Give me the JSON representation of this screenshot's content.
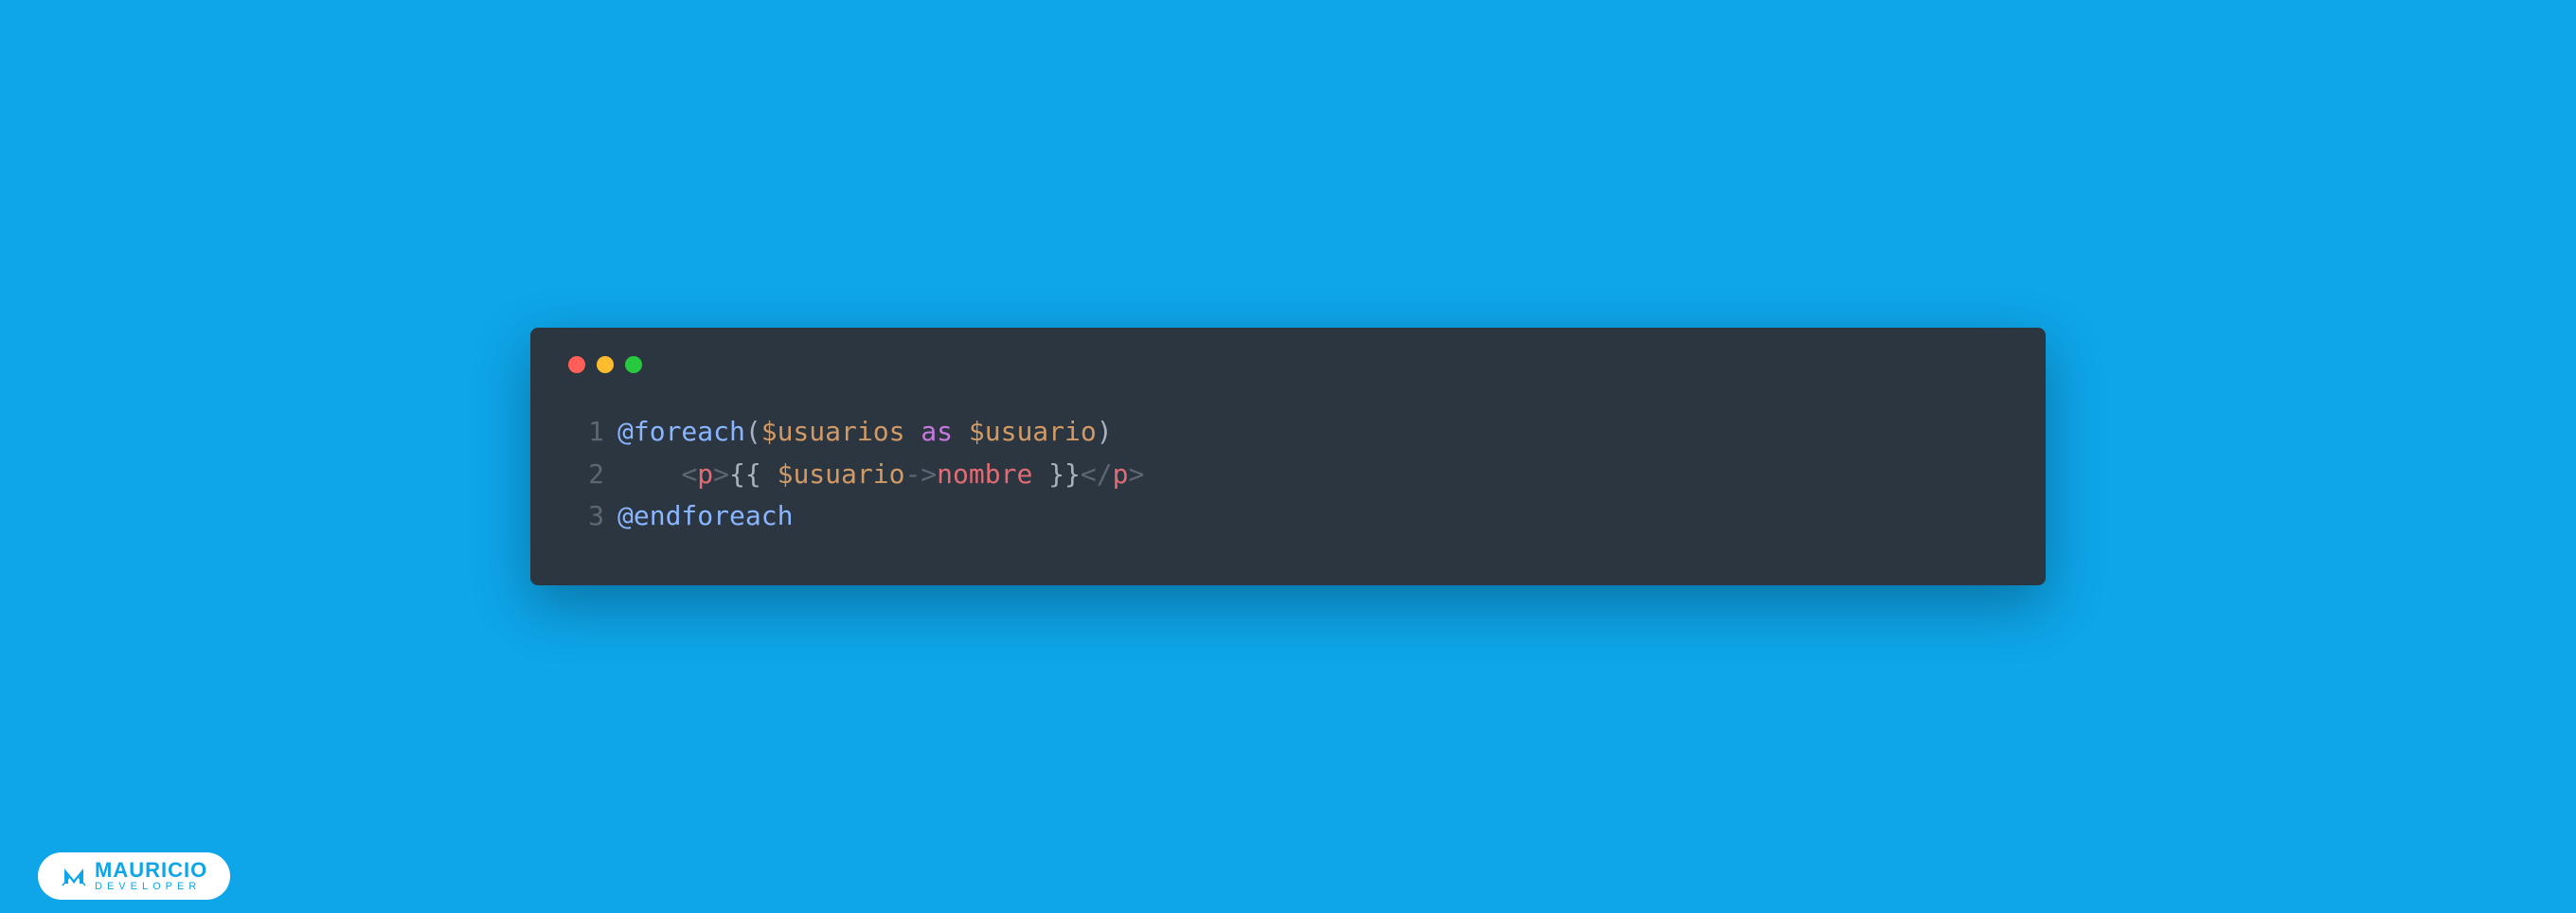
{
  "code": {
    "lines": [
      {
        "number": "1",
        "tokens": {
          "directive": "@foreach",
          "paren_open": "(",
          "var1": "$usuarios",
          "space1": " ",
          "keyword": "as",
          "space2": " ",
          "var2": "$usuario",
          "paren_close": ")"
        }
      },
      {
        "number": "2",
        "tokens": {
          "indent": "    ",
          "tag_open1": "<",
          "tagname1": "p",
          "tag_close1": ">",
          "brace_open": "{{ ",
          "var": "$usuario",
          "arrow": "->",
          "property": "nombre",
          "brace_close": " }}",
          "tag_open2": "</",
          "tagname2": "p",
          "tag_close2": ">"
        }
      },
      {
        "number": "3",
        "tokens": {
          "directive": "@endforeach"
        }
      }
    ]
  },
  "logo": {
    "title": "MAURICIO",
    "subtitle": "DEVELOPER"
  }
}
